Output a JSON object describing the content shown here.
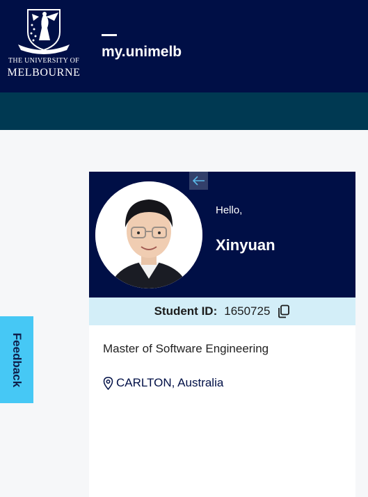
{
  "header": {
    "logo": {
      "line1": "THE UNIVERSITY OF",
      "line2": "MELBOURNE",
      "crest_icon": "university-crest-icon",
      "motto": "POSTERA CRESCAM LAUDE"
    },
    "brand_title": "my.unimelb"
  },
  "profile": {
    "back_icon": "arrow-left-icon",
    "greeting": "Hello,",
    "name": "Xinyuan",
    "student_id_label": "Student ID:",
    "student_id": "1650725",
    "copy_icon": "copy-icon",
    "degree": "Master of Software Engineering",
    "location_icon": "map-pin-icon",
    "location": "CARLTON, Australia"
  },
  "feedback": {
    "label": "Feedback"
  },
  "colors": {
    "navy": "#000f46",
    "teal_bar": "#003952",
    "id_bar": "#d3eef8",
    "feedback": "#46c8f5",
    "page_bg": "#f6f7f9"
  }
}
